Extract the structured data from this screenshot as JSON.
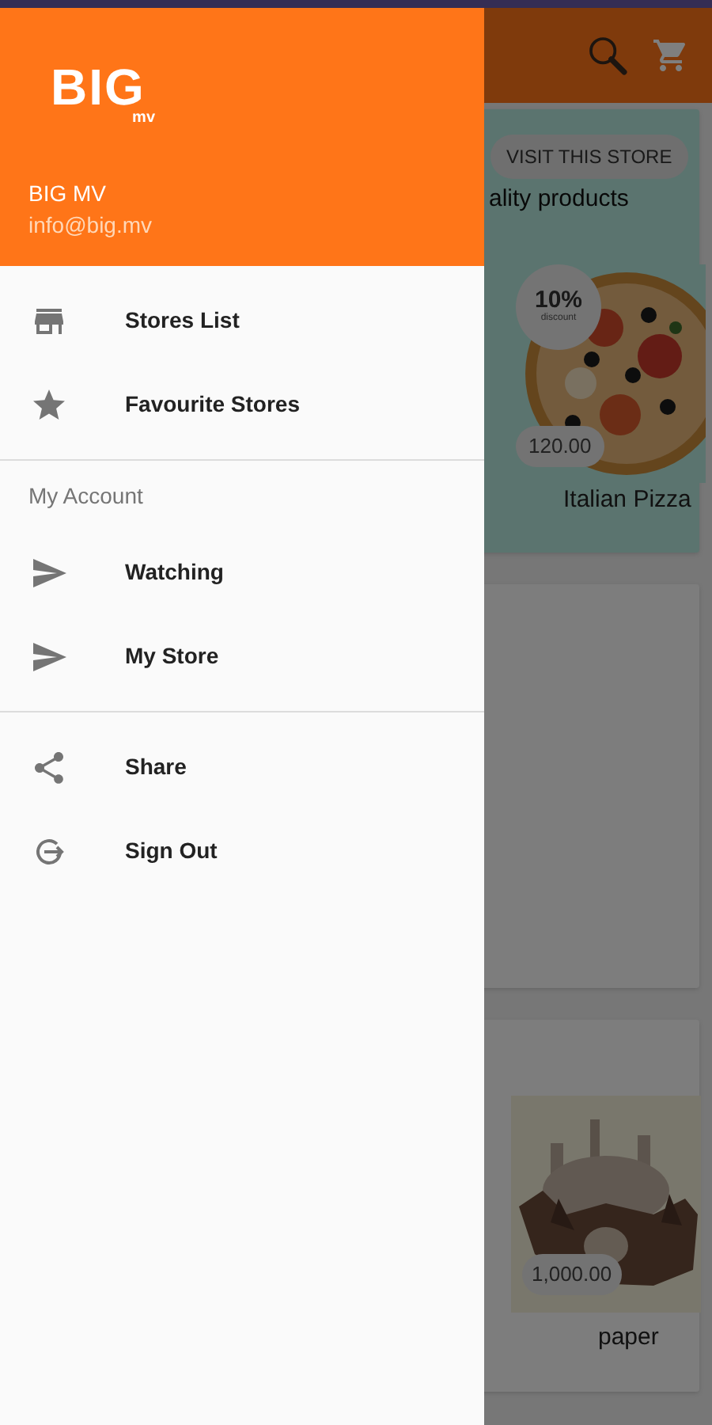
{
  "product_cards": [
    {
      "button": "VISIT THIS STORE",
      "text": "ality products",
      "discount": "10%",
      "discount_label": "discount",
      "price": "120.00",
      "name": "Italian Pizza"
    },
    {
      "price": "1,000.00",
      "name": "paper"
    }
  ],
  "drawer": {
    "header": {
      "logo": "BIG",
      "logo_sub": "mv",
      "name": "BIG MV",
      "email": "info@big.mv"
    },
    "sections": [
      {
        "items": [
          {
            "label": "Stores List"
          },
          {
            "label": "Favourite Stores"
          }
        ]
      },
      {
        "title": "My Account",
        "items": [
          {
            "label": "Watching"
          },
          {
            "label": "My Store"
          }
        ]
      },
      {
        "items": [
          {
            "label": "Share"
          },
          {
            "label": "Sign Out"
          }
        ]
      }
    ]
  }
}
